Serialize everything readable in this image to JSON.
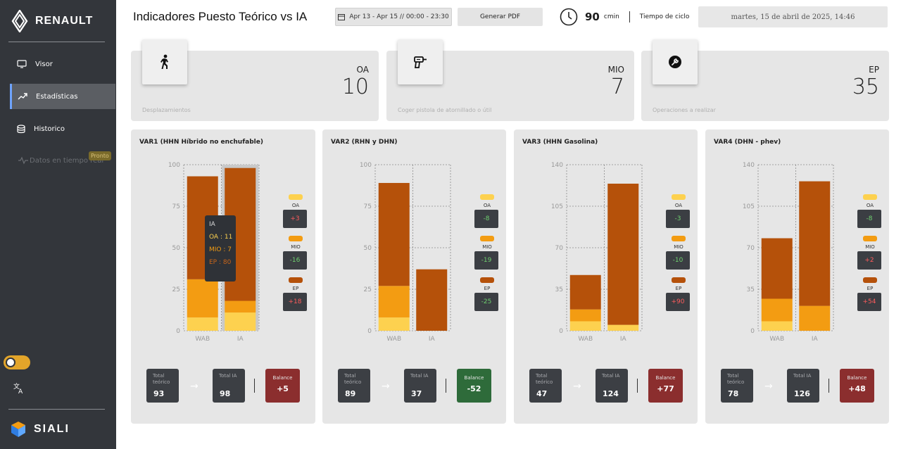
{
  "sidebar": {
    "brand": "RENAULT",
    "items": [
      {
        "label": "Visor"
      },
      {
        "label": "Estadísticas"
      },
      {
        "label": "Historico"
      },
      {
        "label": "Datos en tiempo real",
        "badge": "Pronto"
      }
    ],
    "footer_brand": "SIALI"
  },
  "header": {
    "title": "Indicadores Puesto Teórico vs IA",
    "date_range": "Apr 13 - Apr 15 // 00:00 - 23:30",
    "pdf_button": "Generar PDF",
    "cycle_value": "90",
    "cycle_unit": "cmin",
    "cycle_label": "Tiempo de ciclo",
    "datetime": "martes, 15 de abril de 2025, 14:46"
  },
  "kpis": [
    {
      "code": "OA",
      "value": "10",
      "desc": "Desplazamientos",
      "icon": "walking-person-icon"
    },
    {
      "code": "MIO",
      "value": "7",
      "desc": "Coger pistola de atornillado o útil",
      "icon": "screw-gun-icon"
    },
    {
      "code": "EP",
      "value": "35",
      "desc": "Operaciones a realizar",
      "icon": "wrench-icon"
    }
  ],
  "colors": {
    "oa": "#fdd14f",
    "mio": "#f39c12",
    "ep": "#b5510a",
    "pos_bal": "#8b2e2e",
    "neg_bal": "#2e6b3a"
  },
  "chart_data": [
    {
      "type": "bar",
      "title": "VAR1 (HHN Híbrido no enchufable)",
      "categories": [
        "WAB",
        "IA"
      ],
      "series": [
        {
          "name": "OA",
          "values": [
            8,
            11
          ]
        },
        {
          "name": "MIO",
          "values": [
            23,
            7
          ]
        },
        {
          "name": "EP",
          "values": [
            62,
            80
          ]
        }
      ],
      "ylim": [
        0,
        100
      ],
      "yticks": [
        "0",
        "25",
        "50",
        "75",
        "100"
      ],
      "legend": [
        {
          "label": "OA",
          "diff": "+3"
        },
        {
          "label": "MIO",
          "diff": "-16"
        },
        {
          "label": "EP",
          "diff": "+18"
        }
      ],
      "totals": {
        "teo_label": "Total teórico",
        "teo": "93",
        "ia_label": "Total IA",
        "ia": "98",
        "bal_label": "Balance",
        "bal": "+5"
      },
      "tooltip": {
        "title": "IA",
        "oa": "OA : 11",
        "mio": "MIO : 7",
        "ep": "EP : 80"
      }
    },
    {
      "type": "bar",
      "title": "VAR2 (RHN y DHN)",
      "categories": [
        "WAB",
        "IA"
      ],
      "series": [
        {
          "name": "OA",
          "values": [
            8,
            0
          ]
        },
        {
          "name": "MIO",
          "values": [
            19,
            0
          ]
        },
        {
          "name": "EP",
          "values": [
            62,
            37
          ]
        }
      ],
      "ylim": [
        0,
        100
      ],
      "yticks": [
        "0",
        "25",
        "50",
        "75",
        "100"
      ],
      "legend": [
        {
          "label": "OA",
          "diff": "-8"
        },
        {
          "label": "MIO",
          "diff": "-19"
        },
        {
          "label": "EP",
          "diff": "-25"
        }
      ],
      "totals": {
        "teo_label": "Total teórico",
        "teo": "89",
        "ia_label": "Total IA",
        "ia": "37",
        "bal_label": "Balance",
        "bal": "-52"
      }
    },
    {
      "type": "bar",
      "title": "VAR3 (HHN Gasolina)",
      "categories": [
        "WAB",
        "IA"
      ],
      "series": [
        {
          "name": "OA",
          "values": [
            8,
            5
          ]
        },
        {
          "name": "MIO",
          "values": [
            10,
            0
          ]
        },
        {
          "name": "EP",
          "values": [
            29,
            119
          ]
        }
      ],
      "ylim": [
        0,
        140
      ],
      "yticks": [
        "0",
        "35",
        "70",
        "105",
        "140"
      ],
      "legend": [
        {
          "label": "OA",
          "diff": "-3"
        },
        {
          "label": "MIO",
          "diff": "-10"
        },
        {
          "label": "EP",
          "diff": "+90"
        }
      ],
      "totals": {
        "teo_label": "Total teórico",
        "teo": "47",
        "ia_label": "Total IA",
        "ia": "124",
        "bal_label": "Balance",
        "bal": "+77"
      }
    },
    {
      "type": "bar",
      "title": "VAR4 (DHN - phev)",
      "categories": [
        "WAB",
        "IA"
      ],
      "series": [
        {
          "name": "OA",
          "values": [
            8,
            0
          ]
        },
        {
          "name": "MIO",
          "values": [
            19,
            21
          ]
        },
        {
          "name": "EP",
          "values": [
            51,
            105
          ]
        }
      ],
      "ylim": [
        0,
        140
      ],
      "yticks": [
        "0",
        "35",
        "70",
        "105",
        "140"
      ],
      "legend": [
        {
          "label": "OA",
          "diff": "-8"
        },
        {
          "label": "MIO",
          "diff": "+2"
        },
        {
          "label": "EP",
          "diff": "+54"
        }
      ],
      "totals": {
        "teo_label": "Total teórico",
        "teo": "78",
        "ia_label": "Total IA",
        "ia": "126",
        "bal_label": "Balance",
        "bal": "+48"
      }
    }
  ]
}
